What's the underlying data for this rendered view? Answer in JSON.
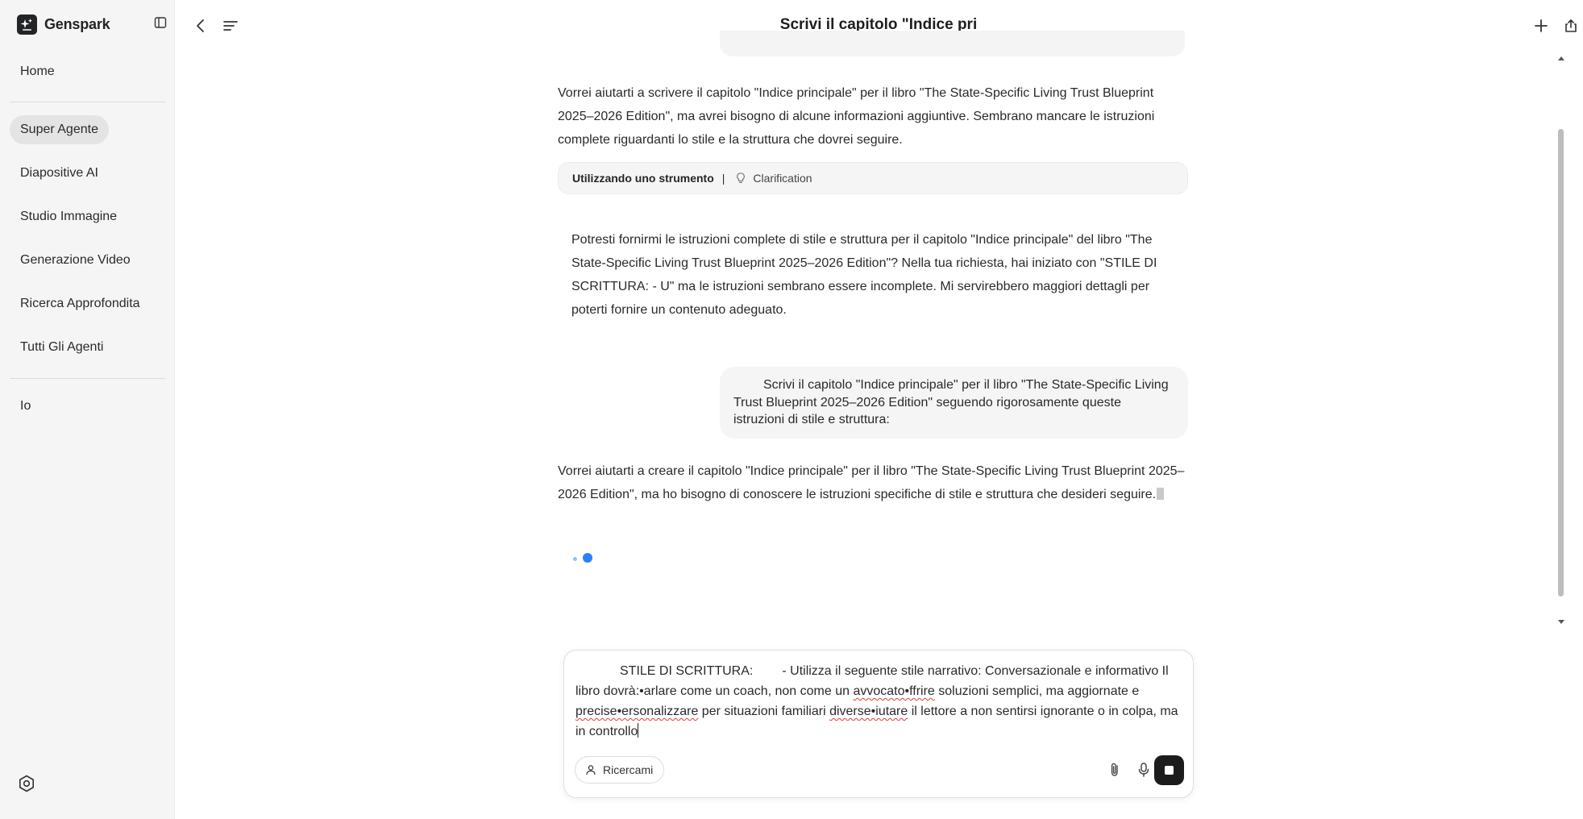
{
  "app": {
    "brand": "Genspark",
    "title": "Scrivi il capitolo \"Indice pri"
  },
  "sidebar": {
    "items": [
      {
        "label": "Home"
      },
      {
        "label": "Super Agente",
        "active": true
      },
      {
        "label": "Diapositive AI"
      },
      {
        "label": "Studio Immagine"
      },
      {
        "label": "Generazione Video"
      },
      {
        "label": "Ricerca Approfondita"
      },
      {
        "label": "Tutti Gli Agenti"
      },
      {
        "label": "Io"
      }
    ]
  },
  "chat": {
    "assistant_msg_1": "Vorrei aiutarti a scrivere il capitolo \"Indice principale\" per il libro \"The State-Specific Living Trust Blueprint 2025–2026 Edition\", ma avrei bisogno di alcune informazioni aggiuntive. Sembrano mancare le istruzioni complete riguardanti lo stile e la struttura che dovrei seguire.",
    "tool": {
      "label": "Utilizzando uno strumento",
      "separator": "|",
      "name": "Clarification"
    },
    "clarification_text": "Potresti fornirmi le istruzioni complete di stile e struttura per il capitolo \"Indice principale\" del libro \"The State-Specific Living Trust Blueprint 2025–2026 Edition\"? Nella tua richiesta, hai iniziato con \"STILE DI SCRITTURA: - U\" ma le istruzioni sembrano essere incomplete. Mi servirebbero maggiori dettagli per poterti fornire un contenuto adeguato.",
    "user_msg": "Scrivi il capitolo \"Indice principale\" per il libro \"The State-Specific Living Trust Blueprint 2025–2026 Edition\" seguendo rigorosamente queste istruzioni di stile e struttura:",
    "assistant_msg_2": "Vorrei aiutarti a creare il capitolo \"Indice principale\" per il libro \"The State-Specific Living Trust Blueprint 2025–2026 Edition\", ma ho bisogno di conoscere le istruzioni specifiche di stile e struttura che desideri seguire."
  },
  "composer": {
    "segments": {
      "s1": "STILE DI SCRITTURA:",
      "s2": "- Utilizza il seguente stile narrativo: Conversazionale e informativo Il libro dovrà:•arlare come un coach, non come un ",
      "w1": "avvocato•ffrire",
      "s3": " soluzioni semplici, ma aggiornate e ",
      "w2": "precise•ersonalizzare",
      "s4": " per situazioni familiari ",
      "w3": "diverse•iutare",
      "s5": " il lettore a non sentirsi ignorante o in colpa, ma in controllo"
    },
    "ricercami_label": "Ricercami"
  },
  "colors": {
    "sidebar_bg": "#f5f5f5",
    "active_item_bg": "#e4e4e4",
    "loader_blue": "#2b7ff7",
    "stop_button": "#1c1c1c"
  },
  "icons": [
    "genspark-logo-icon",
    "sidebar-toggle-icon",
    "back-icon",
    "menu-icon",
    "plus-icon",
    "share-icon",
    "lightbulb-icon",
    "settings-icon",
    "person-icon",
    "paperclip-icon",
    "microphone-icon",
    "stop-icon"
  ]
}
